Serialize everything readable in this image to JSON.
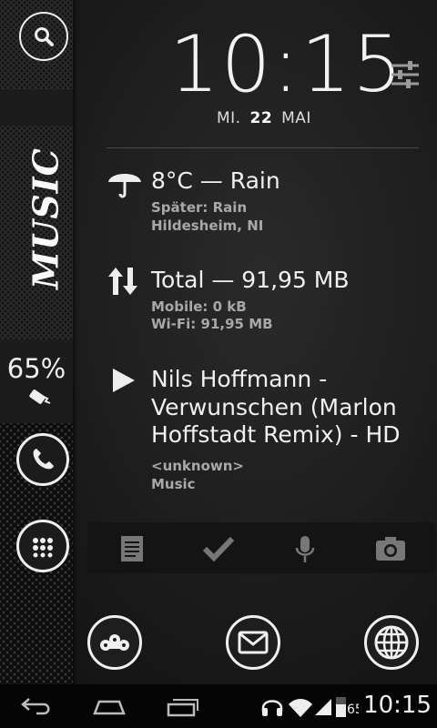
{
  "clock": {
    "time": "10:15"
  },
  "date": {
    "weekday": "MI.",
    "day": "22",
    "month": "MAI"
  },
  "sidebar": {
    "music_label": "MUSIC",
    "battery_percent": "65%"
  },
  "weather": {
    "title": "8°C — Rain",
    "later": "Später: Rain",
    "location": "Hildesheim, NI"
  },
  "data_usage": {
    "title": "Total — 91,95 MB",
    "mobile": "Mobile: 0 kB",
    "wifi": "Wi-Fi: 91,95 MB"
  },
  "now_playing": {
    "line1": "Nils Hoffmann -",
    "line2": "Verwunschen (Marlon",
    "line3": "Hoffstadt Remix) - HD",
    "artist": "<unknown>",
    "source": "Music"
  },
  "shortcuts": [
    "notes-icon",
    "check-icon",
    "mic-icon",
    "camera-icon"
  ],
  "dock": [
    "app-icon",
    "mail-icon",
    "browser-icon"
  ],
  "status_bar": {
    "time": "10:15",
    "battery_level": "65"
  },
  "colors": {
    "background": "#1a1a1a",
    "text": "#f0f0f0",
    "subtext": "#a8a8a8"
  }
}
